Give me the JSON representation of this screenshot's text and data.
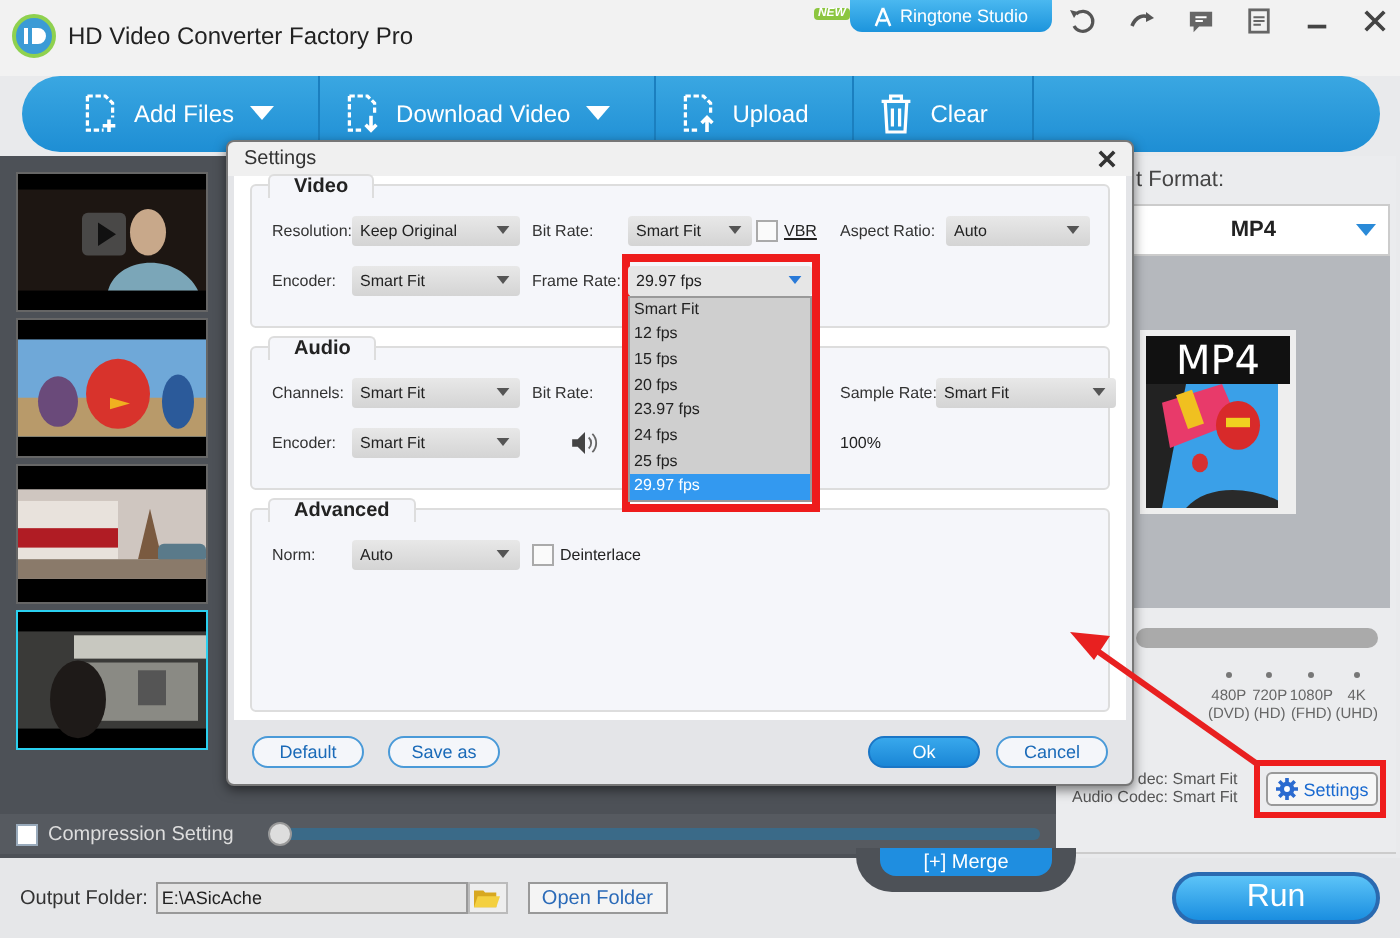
{
  "window": {
    "title": "HD Video Converter Factory Pro"
  },
  "title_bar": {
    "badge": "NEW",
    "ringtone_button": "Ringtone Studio"
  },
  "toolbar": [
    {
      "kind": "add",
      "label": "Add Files",
      "dropdown": true
    },
    {
      "kind": "download",
      "label": "Download Video",
      "dropdown": true
    },
    {
      "kind": "upload",
      "label": "Upload",
      "dropdown": false
    },
    {
      "kind": "clear",
      "label": "Clear",
      "dropdown": false
    }
  ],
  "files": [
    {
      "kind": "picture",
      "selected": false
    },
    {
      "kind": "picture",
      "selected": false
    },
    {
      "kind": "picture",
      "selected": false
    },
    {
      "kind": "picture",
      "selected": true
    }
  ],
  "compression": {
    "label": "Compression Setting",
    "checked": false,
    "level": 0
  },
  "output": {
    "label": "Output Folder:",
    "value": "E:\\ASicAche",
    "open_button": "Open Folder"
  },
  "merge_button": "[+] Merge",
  "run_button": "Run",
  "format_panel": {
    "label": "t Format:",
    "format": "MP4",
    "icon_text": "MP4",
    "quality_levels": [
      {
        "label": "480P",
        "sub": "(DVD)"
      },
      {
        "label": "720P",
        "sub": "(HD)"
      },
      {
        "label": "1080P",
        "sub": "(FHD)"
      },
      {
        "label": "4K",
        "sub": "(UHD)"
      }
    ],
    "video_codec": "dec: Smart Fit",
    "audio_codec": "Audio Codec: Smart Fit",
    "settings_button": "Settings"
  },
  "dialog": {
    "title": "Settings",
    "sections": [
      {
        "title": "Video",
        "rows": [
          [
            {
              "kind": "select",
              "label": "Resolution:",
              "value": "Keep Original"
            },
            {
              "kind": "select",
              "label": "Bit Rate:",
              "value": "Smart Fit"
            },
            {
              "kind": "checkbox",
              "label": "VBR",
              "checked": false
            },
            {
              "kind": "select",
              "label": "Aspect Ratio:",
              "value": "Auto"
            }
          ],
          [
            {
              "kind": "select",
              "label": "Encoder:",
              "value": "Smart Fit"
            },
            {
              "kind": "select",
              "label": "Frame Rate:",
              "value": "29.97 fps",
              "open": true,
              "options": [
                {
                  "label": "Smart Fit",
                  "selected": false
                },
                {
                  "label": "12 fps",
                  "selected": false
                },
                {
                  "label": "15 fps",
                  "selected": false
                },
                {
                  "label": "20 fps",
                  "selected": false
                },
                {
                  "label": "23.97 fps",
                  "selected": false
                },
                {
                  "label": "24 fps",
                  "selected": false
                },
                {
                  "label": "25 fps",
                  "selected": false
                },
                {
                  "label": "29.97 fps",
                  "selected": true
                }
              ]
            }
          ]
        ]
      },
      {
        "title": "Audio",
        "rows": [
          [
            {
              "kind": "select",
              "label": "Channels:",
              "value": "Smart Fit"
            },
            {
              "kind": "label",
              "label": "Bit Rate:"
            },
            {
              "kind": "select",
              "label": "Sample Rate:",
              "value": "Smart Fit"
            }
          ],
          [
            {
              "kind": "select",
              "label": "Encoder:",
              "value": "Smart Fit"
            },
            {
              "kind": "volume"
            },
            {
              "kind": "reading",
              "reading": "100%"
            }
          ]
        ]
      },
      {
        "title": "Advanced",
        "rows": [
          [
            {
              "kind": "select",
              "label": "Norm:",
              "value": "Auto"
            },
            {
              "kind": "checkbox",
              "label": "Deinterlace",
              "checked": false
            }
          ]
        ]
      }
    ],
    "buttons": [
      {
        "kind": "default",
        "label": "Default"
      },
      {
        "kind": "default",
        "label": "Save as"
      },
      {
        "kind": "primary",
        "label": "Ok"
      },
      {
        "kind": "default",
        "label": "Cancel"
      }
    ]
  }
}
